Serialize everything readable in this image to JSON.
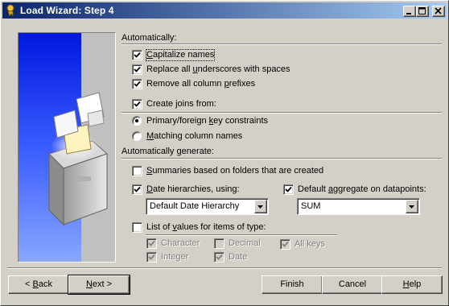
{
  "window": {
    "title": "Load Wizard: Step 4"
  },
  "automatically": {
    "heading": "Automatically:",
    "capitalize_names": {
      "pre": "",
      "key": "C",
      "post": "apitalize names",
      "checked": true
    },
    "replace_underscores": {
      "pre": "Replace all ",
      "key": "u",
      "post": "nderscores with spaces",
      "checked": true
    },
    "remove_prefixes": {
      "pre": "Remove all column ",
      "key": "p",
      "post": "refixes",
      "checked": true
    },
    "create_joins": {
      "pre": "Create ",
      "key": "j",
      "post": "oins from:",
      "checked": true
    }
  },
  "joins_from": {
    "primary_foreign": {
      "pre": "Primary/foreign ",
      "key": "k",
      "post": "ey constraints",
      "selected": true
    },
    "matching_columns": {
      "pre": "",
      "key": "M",
      "post": "atching column names",
      "selected": false
    }
  },
  "generate": {
    "heading": "Automatically generate:",
    "summaries": {
      "pre": "",
      "key": "S",
      "post": "ummaries based on folders that are created",
      "checked": false
    },
    "date_hierarchies": {
      "pre": "",
      "key": "D",
      "post": "ate hierarchies, using:",
      "checked": true
    },
    "date_hierarchy_value": "Default Date Hierarchy",
    "default_aggregate": {
      "pre": "Default ",
      "key": "a",
      "post": "ggregate on datapoints:",
      "checked": true
    },
    "aggregate_value": "SUM",
    "list_of_values": {
      "pre": "List of ",
      "key": "v",
      "post": "alues for items of type:",
      "checked": false
    }
  },
  "types": {
    "character": {
      "label": "Character",
      "checked": true
    },
    "decimal": {
      "label": "Decimal",
      "checked": false
    },
    "all_keys": {
      "label": "All keys",
      "checked": true
    },
    "integer": {
      "label": "Integer",
      "checked": true
    },
    "date": {
      "label": "Date",
      "checked": true
    }
  },
  "buttons": {
    "back": {
      "pre": "< ",
      "key": "B",
      "post": "ack"
    },
    "next": {
      "pre": "",
      "key": "N",
      "post": "ext >"
    },
    "finish": "Finish",
    "cancel": "Cancel",
    "help": {
      "pre": "",
      "key": "H",
      "post": "elp"
    }
  }
}
